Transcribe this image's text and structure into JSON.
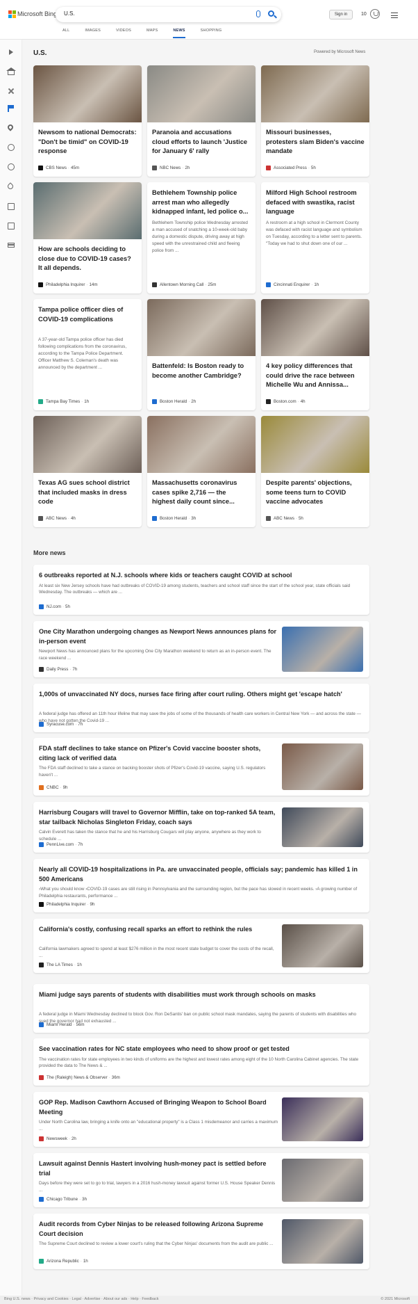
{
  "header": {
    "logo_text": "Microsoft Bing",
    "search_value": "U.S.",
    "signin_label": "Sign in",
    "points": "10",
    "tabs": [
      "ALL",
      "IMAGES",
      "VIDEOS",
      "MAPS",
      "NEWS",
      "SHOPPING"
    ],
    "active_tab": "NEWS"
  },
  "main": {
    "section_title": "U.S.",
    "powered_by": "Powered by Microsoft News",
    "cards": [
      {
        "title": "Newsom to national Democrats: \"Don't be timid\" on COVID-19 response",
        "source": "CBS News",
        "age": "45m",
        "color": "#6b5543"
      },
      {
        "title": "Paranoia and accusations cloud efforts to launch 'Justice for January 6' rally",
        "source": "NBC News",
        "age": "2h",
        "color": "#8a8a85"
      },
      {
        "title": "Missouri businesses, protesters slam Biden's vaccine mandate",
        "source": "Associated Press",
        "age": "5h",
        "color": "#7e6a50"
      },
      {
        "title": "How are schools deciding to close due to COVID-19 cases? It all depends.",
        "source": "Philadelphia Inquirer",
        "age": "14m",
        "color": "#5a6d70"
      },
      {
        "title": "Bethlehem Township police arrest man who allegedly kidnapped infant, led police o...",
        "snippet": "Bethlehem Township police Wednesday arrested a man accused of snatching a 10-week-old baby during a domestic dispute, driving away at high speed with the unrestrained child and fleeing police from ...",
        "source": "Allentown Morning Call",
        "age": "25m"
      },
      {
        "title": "Milford High School restroom defaced with swastika, racist language",
        "snippet": "A restroom at a high school in Clermont County was defaced with racist language and symbolism on Tuesday, according to a letter sent to parents. \"Today we had to shut down one of our ...",
        "source": "Cincinnati Enquirer",
        "age": "1h"
      },
      {
        "title": "Tampa police officer dies of COVID-19 complications",
        "snippet": "A 37-year-old Tampa police officer has died following complications from the coronavirus, according to the Tampa Police Department. Officer Matthew S. Coleman's death was announced by the department ...",
        "source": "Tampa Bay Times",
        "age": "1h"
      },
      {
        "title": "Battenfeld: Is Boston ready to become another Cambridge?",
        "source": "Boston Herald",
        "age": "2h",
        "color": "#7b6a5c"
      },
      {
        "title": "4 key policy differences that could drive the race between Michelle Wu and Annissa...",
        "source": "Boston.com",
        "age": "4h",
        "color": "#5f5048"
      },
      {
        "title": "Texas AG sues school district that included masks in dress code",
        "source": "ABC News",
        "age": "4h",
        "color": "#6d6058"
      },
      {
        "title": "Massachusetts coronavirus cases spike 2,716 — the highest daily count since...",
        "source": "Boston Herald",
        "age": "3h",
        "color": "#8a7060"
      },
      {
        "title": "Despite parents' objections, some teens turn to COVID vaccine advocates",
        "source": "ABC News",
        "age": "5h",
        "color": "#9a8a3a"
      }
    ]
  },
  "more": {
    "title": "More news",
    "items": [
      {
        "title": "6 outbreaks reported at N.J. schools where kids or teachers caught COVID at school",
        "snippet": "At least six New Jersey schools have had outbreaks of COVID-19 among students, teachers and school staff since the start of the school year, state officials said Wednesday. The outbreaks — which are ...",
        "source": "NJ.com",
        "age": "5h"
      },
      {
        "title": "One City Marathon undergoing changes as Newport News announces plans for in-person event",
        "snippet": "Newport News has announced plans for the upcoming One City Marathon weekend to return as an in-person event. The race weekend ...",
        "source": "Daily Press",
        "age": "7h"
      },
      {
        "title": "1,000s of unvaccinated NY docs, nurses face firing after court ruling. Others might get 'escape hatch'",
        "snippet": "A federal judge has offered an 11th hour lifeline that may save the jobs of some of the thousands of health care workers in Central New York — and across the state — who have not gotten the Covid-19 ...",
        "source": "Syracuse.com",
        "age": "7h"
      },
      {
        "title": "FDA staff declines to take stance on Pfizer's Covid vaccine booster shots, citing lack of verified data",
        "snippet": "The FDA staff declined to take a stance on backing booster shots of Pfizer's Covid-19 vaccine, saying U.S. regulators haven't ...",
        "source": "CNBC",
        "age": "9h"
      },
      {
        "title": "Harrisburg Cougars will travel to Governor Mifflin, take on top-ranked 5A team, star tailback Nicholas Singleton Friday, coach says",
        "snippet": "Calvin Everett has taken the stance that he and his Harrisburg Cougars will play anyone, anywhere as they work to schedule ...",
        "source": "PennLive.com",
        "age": "7h"
      },
      {
        "title": "Nearly all COVID-19 hospitalizations in Pa. are unvaccinated people, officials say; pandemic has killed 1 in 500 Americans",
        "snippet": "›What you should know ›COVID-19 cases are still rising in Pennsylvania and the surrounding region, but the pace has slowed in recent weeks. ›A growing number of Philadelphia restaurants, performance ...",
        "source": "Philadelphia Inquirer",
        "age": "9h"
      },
      {
        "title": "California's costly, confusing recall sparks an effort to rethink the rules",
        "snippet": "California lawmakers agreed to spend at least $276 million in the most recent state budget to cover the costs of the recall, ...",
        "source": "The LA Times",
        "age": "1h"
      },
      {
        "title": "Miami judge says parents of students with disabilities must work through schools on masks",
        "snippet": "A federal judge in Miami Wednesday declined to block Gov. Ron DeSantis' ban on public school mask mandates, saying the parents of students with disabilities who sued the governor had not exhausted ...",
        "source": "Miami Herald",
        "age": "56m"
      },
      {
        "title": "See vaccination rates for NC state employees who need to show proof or get tested",
        "snippet": "The vaccination rates for state employees in two kinds of uniforms are the highest and lowest rates among eight of the 10 North Carolina Cabinet agencies. The state provided the data to The News & ...",
        "source": "The (Raleigh) News & Observer",
        "age": "36m"
      },
      {
        "title": "GOP Rep. Madison Cawthorn Accused of Bringing Weapon to School Board Meeting",
        "snippet": "Under North Carolina law, bringing a knife onto an \"educational property\" is a Class 1 misdemeanor and carries a maximum ...",
        "source": "Newsweek",
        "age": "2h"
      },
      {
        "title": "Lawsuit against Dennis Hastert involving hush-money pact is settled before trial",
        "snippet": "Days before they were set to go to trial, lawyers in a 2016 hush-money lawsuit against former U.S. House Speaker Dennis ...",
        "source": "Chicago Tribune",
        "age": "3h"
      },
      {
        "title": "Audit records from Cyber Ninjas to be released following Arizona Supreme Court decision",
        "snippet": "The Supreme Court declined to review a lower court's ruling that the Cyber Ninjas' documents from the audit are public ...",
        "source": "Arizona Republic",
        "age": "1h"
      }
    ]
  },
  "footer": {
    "left": "Bing U.S. news · Privacy and Cookies · Legal · Advertise · About our ads · Help · Feedback",
    "right": "© 2021 Microsoft"
  }
}
